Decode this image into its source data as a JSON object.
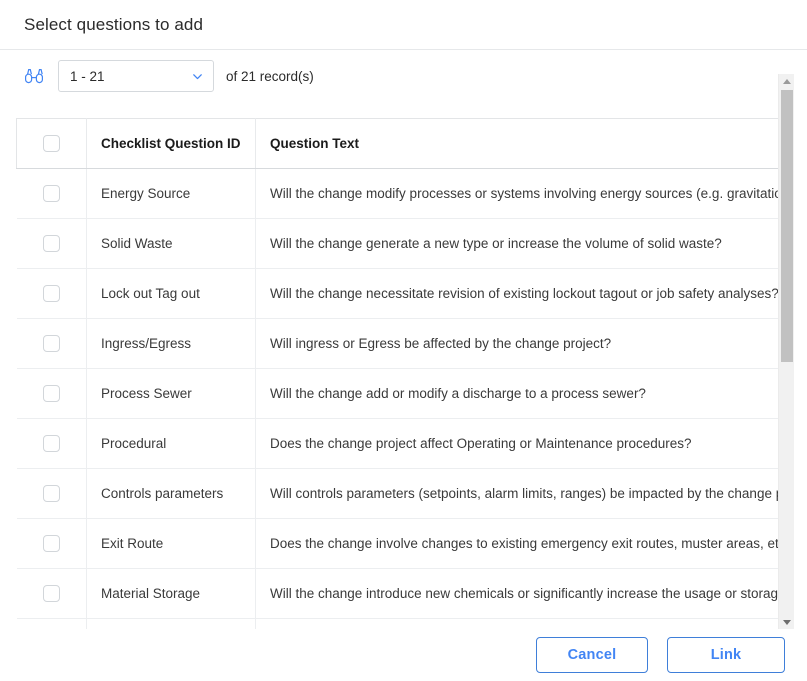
{
  "dialog": {
    "title": "Select questions to add"
  },
  "toolbar": {
    "search_icon": "binoculars-icon",
    "range_value": "1 - 21",
    "range_chevron_icon": "chevron-down-icon",
    "record_count_text": "of 21  record(s)"
  },
  "table": {
    "columns": [
      {
        "key": "select",
        "label": ""
      },
      {
        "key": "question_id",
        "label": "Checklist Question ID"
      },
      {
        "key": "question_text",
        "label": "Question Text"
      }
    ],
    "rows": [
      {
        "question_id": "Energy Source",
        "question_text": "Will the change modify processes or systems involving energy sources (e.g. gravitational, hydra"
      },
      {
        "question_id": "Solid Waste",
        "question_text": "Will the change generate a new type or increase the volume of solid waste?"
      },
      {
        "question_id": "Lock out Tag out",
        "question_text": "Will the change necessitate revision of existing lockout tagout or job safety analyses?"
      },
      {
        "question_id": "Ingress/Egress",
        "question_text": "Will ingress or Egress be affected by the change project?"
      },
      {
        "question_id": "Process Sewer",
        "question_text": "Will the change add or modify a discharge to a process sewer?"
      },
      {
        "question_id": "Procedural",
        "question_text": "Does the change project affect Operating or Maintenance procedures?"
      },
      {
        "question_id": "Controls parameters",
        "question_text": "Will controls parameters (setpoints, alarm limits, ranges) be impacted by the change project?"
      },
      {
        "question_id": "Exit Route",
        "question_text": "Does the change involve changes to existing emergency exit routes, muster areas, etc?"
      },
      {
        "question_id": "Material Storage",
        "question_text": "Will the change introduce new chemicals or significantly increase the usage or storage of an ex"
      },
      {
        "question_id": "",
        "question_text": ""
      }
    ]
  },
  "scrollbar": {
    "up_arrow_icon": "scroll-up-arrow-icon",
    "down_arrow_icon": "scroll-down-arrow-icon"
  },
  "footer": {
    "cancel_label": "Cancel",
    "link_label": "Link"
  },
  "colors": {
    "accent_blue": "#4285f4",
    "button_border": "#3f7fd9",
    "text_primary": "#2b2b2b",
    "row_border": "#eceef0",
    "scrollbar_thumb": "#c1c1c1"
  }
}
